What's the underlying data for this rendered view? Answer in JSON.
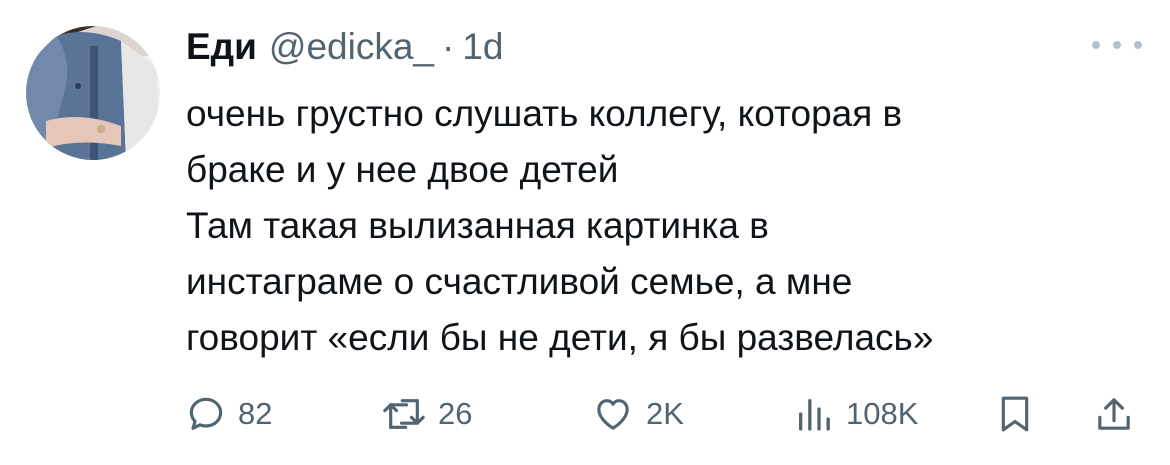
{
  "tweet": {
    "author_name": "Еди",
    "handle": "@edicka_",
    "separator": "·",
    "time": "1d",
    "text_lines": [
      "очень грустно слушать коллегу, которая в",
      "браке и у нее двое детей",
      "Там такая вылизанная картинка в",
      "инстаграме о счастливой семье, а мне",
      "говорит «если бы не дети, я бы развелась»"
    ]
  },
  "actions": {
    "replies": "82",
    "retweets": "26",
    "likes": "2K",
    "views": "108K"
  },
  "icons": {
    "reply": "reply-icon",
    "retweet": "retweet-icon",
    "like": "heart-icon",
    "views": "views-icon",
    "bookmark": "bookmark-icon",
    "share": "share-icon",
    "more": "more-icon"
  },
  "colors": {
    "text": "#0f1419",
    "muted": "#536471",
    "icon": "#536471"
  }
}
